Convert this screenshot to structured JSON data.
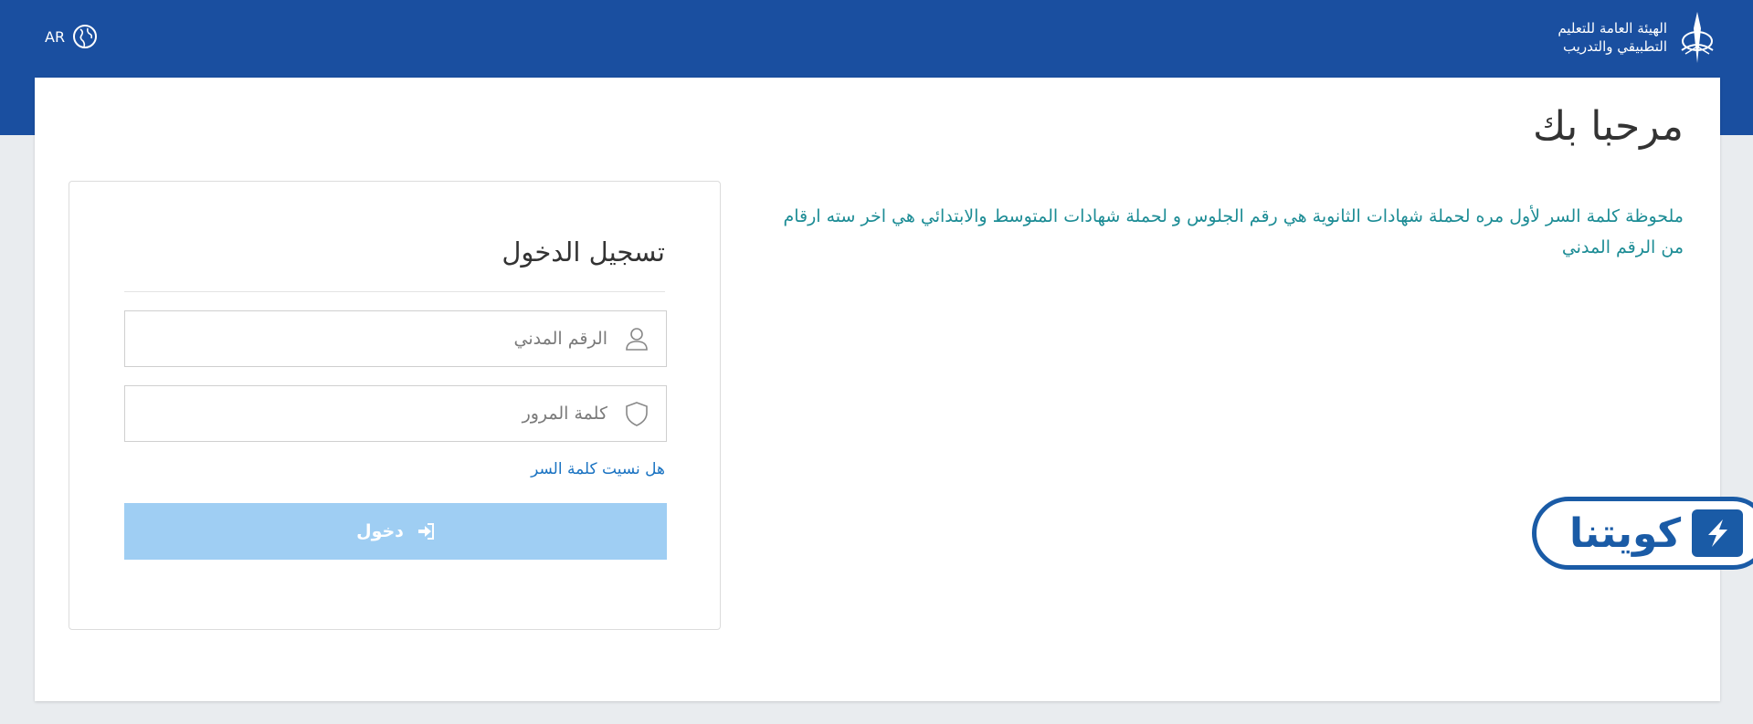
{
  "header": {
    "org_line1": "الهيئة العامة للتعليم",
    "org_line2": "التطبيقي والتدريب",
    "language_label": "AR"
  },
  "main": {
    "welcome": "مرحبا بك",
    "note": "ملحوظة كلمة السر لأول مره لحملة شهادات الثانوية هي رقم الجلوس و لحملة شهادات المتوسط والابتدائي هي اخر سته ارقام من الرقم المدني"
  },
  "login": {
    "title": "تسجيل الدخول",
    "civil_id_placeholder": "الرقم المدني",
    "password_placeholder": "كلمة المرور",
    "forgot_label": "هل نسيت كلمة السر",
    "submit_label": "دخول"
  },
  "watermark": {
    "text": "كويتنا"
  },
  "icons": {
    "user": "user-icon",
    "shield": "shield-icon",
    "sign_in": "sign-in-icon",
    "globe": "globe-icon"
  },
  "colors": {
    "header_bg": "#1a4fa0",
    "note_text": "#1c8c95",
    "link": "#1a73c2",
    "button_bg": "#9fcef3"
  }
}
